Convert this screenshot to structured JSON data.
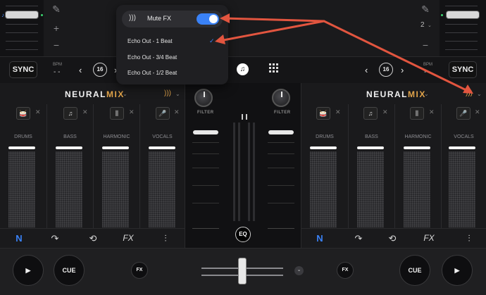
{
  "colors": {
    "accent_blue": "#3a82f7",
    "neural_mix_orange": "#e0a34a",
    "annotation_red": "#e2553f"
  },
  "top": {
    "right_page_number": "2"
  },
  "left_deck": {
    "sync_label": "SYNC",
    "bpm_label": "BPM",
    "bpm_value": "- -",
    "loop_value": "16",
    "neural_title_a": "NEURAL",
    "neural_title_b": "MIX",
    "stems": [
      {
        "label": "DRUMS",
        "icon": "drum-icon"
      },
      {
        "label": "BASS",
        "icon": "guitar-icon"
      },
      {
        "label": "HARMONIC",
        "icon": "harmonic-icon"
      },
      {
        "label": "VOCALS",
        "icon": "microphone-icon"
      }
    ],
    "cue_label": "CUE",
    "fx_label": "FX",
    "tool_fx_label": "FX",
    "tool_n_label": "N"
  },
  "right_deck": {
    "sync_label": "SYNC",
    "bpm_label": "BPM",
    "bpm_value": "- -",
    "loop_value": "16",
    "neural_title_a": "NEURAL",
    "neural_title_b": "MIX",
    "stems": [
      {
        "label": "DRUMS",
        "icon": "drum-icon"
      },
      {
        "label": "BASS",
        "icon": "guitar-icon"
      },
      {
        "label": "HARMONIC",
        "icon": "harmonic-icon"
      },
      {
        "label": "VOCALS",
        "icon": "microphone-icon"
      }
    ],
    "cue_label": "CUE",
    "fx_label": "FX",
    "tool_fx_label": "FX",
    "tool_n_label": "N"
  },
  "mixer": {
    "filter_left": "FILTER",
    "filter_right": "FILTER",
    "eq_label": "EQ"
  },
  "popup": {
    "mute_fx_label": "Mute FX",
    "mute_fx_on": true,
    "items": [
      "Echo Out - 1 Beat",
      "Echo Out - 3/4 Beat",
      "Echo Out - 1/2 Beat"
    ],
    "selected_item": "Echo Out - 1 Beat"
  }
}
